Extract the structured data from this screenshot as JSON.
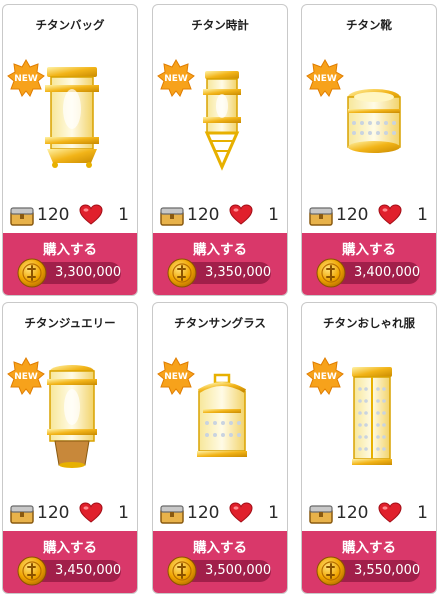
{
  "buy_label": "購入する",
  "new_badge_text": "NEW",
  "items": [
    {
      "title": "チタンバッグ",
      "box_count": "120",
      "heart_count": "1",
      "price": "3,300,000"
    },
    {
      "title": "チタン時計",
      "box_count": "120",
      "heart_count": "1",
      "price": "3,350,000"
    },
    {
      "title": "チタン靴",
      "box_count": "120",
      "heart_count": "1",
      "price": "3,400,000"
    },
    {
      "title": "チタンジュエリー",
      "box_count": "120",
      "heart_count": "1",
      "price": "3,450,000"
    },
    {
      "title": "チタンサングラス",
      "box_count": "120",
      "heart_count": "1",
      "price": "3,500,000"
    },
    {
      "title": "チタンおしゃれ服",
      "box_count": "120",
      "heart_count": "1",
      "price": "3,550,000"
    }
  ],
  "colors": {
    "buy_bg": "#d9386a",
    "price_pill": "#a11f4a",
    "gold": "#f2b418",
    "heart": "#e0202c"
  }
}
